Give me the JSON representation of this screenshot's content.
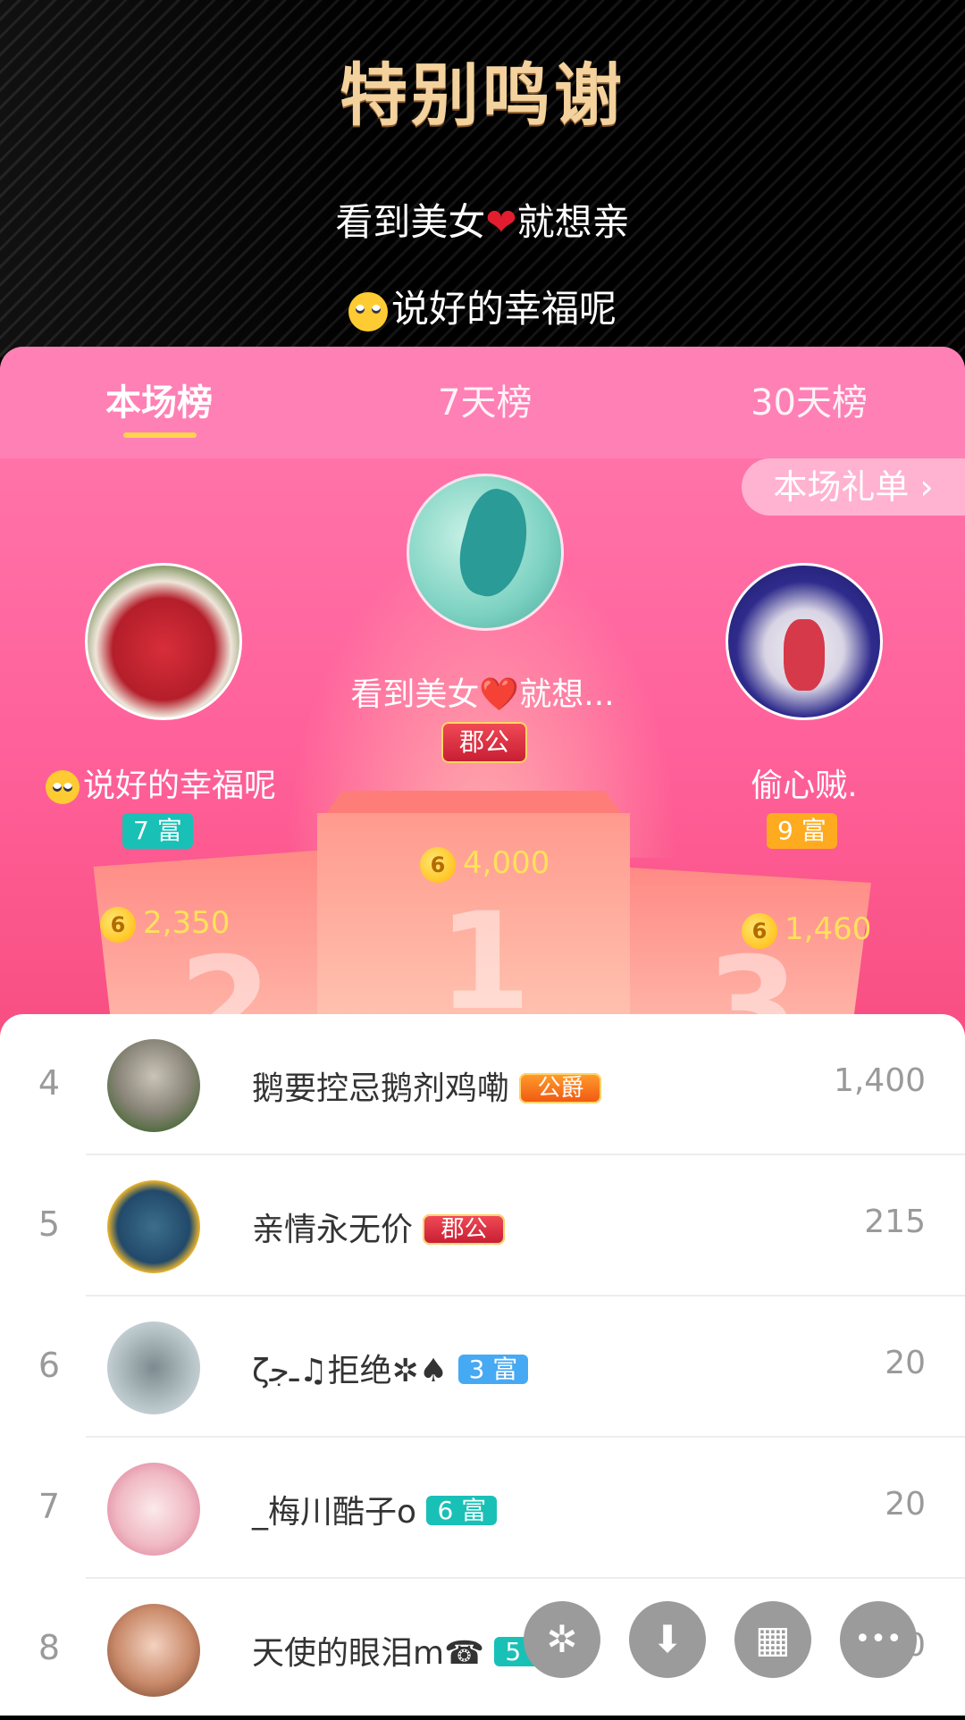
{
  "header": {
    "title": "特别鸣谢",
    "line1_text": "看到美女",
    "line1_after": "就想亲",
    "line2_text": "说好的幸福呢"
  },
  "tabs": [
    {
      "label": "本场榜",
      "active": true
    },
    {
      "label": "7天榜",
      "active": false
    },
    {
      "label": "30天榜",
      "active": false
    }
  ],
  "gift_list_link": "本场礼单 ›",
  "podium": {
    "first": {
      "name": "看到美女❤️就想...",
      "badge": "郡公",
      "score": "4,000",
      "number": "1"
    },
    "second": {
      "name": "说好的幸福呢",
      "badge": "7 富",
      "score": "2,350",
      "number": "2"
    },
    "third": {
      "name": "偷心贼.",
      "badge": "9 富",
      "score": "1,460",
      "number": "3"
    }
  },
  "coin_symbol": "6",
  "rows": [
    {
      "rank": "4",
      "name": "鹅要控忌鹅剂鸡嘞",
      "badge": "公爵",
      "value": "1,400"
    },
    {
      "rank": "5",
      "name": "亲情永无价",
      "badge": "郡公",
      "value": "215"
    },
    {
      "rank": "6",
      "name": "ζـﺟ♫拒绝✲♠",
      "badge": "3 富",
      "value": "20"
    },
    {
      "rank": "7",
      "name": "_梅川酷子o",
      "badge": "6 富",
      "value": "20"
    },
    {
      "rank": "8",
      "name": "天使的眼泪m☎",
      "badge": "5 富",
      "value": "20"
    }
  ],
  "fabs": [
    {
      "icon": "pinwheel-icon",
      "glyph": "✲"
    },
    {
      "icon": "download-icon",
      "glyph": "⬇"
    },
    {
      "icon": "grid-icon",
      "glyph": "▦"
    },
    {
      "icon": "more-icon",
      "glyph": "•••"
    }
  ],
  "colors": {
    "accent": "#ff6099",
    "tab_indicator": "#ffd34d",
    "score": "#ffe15a"
  }
}
